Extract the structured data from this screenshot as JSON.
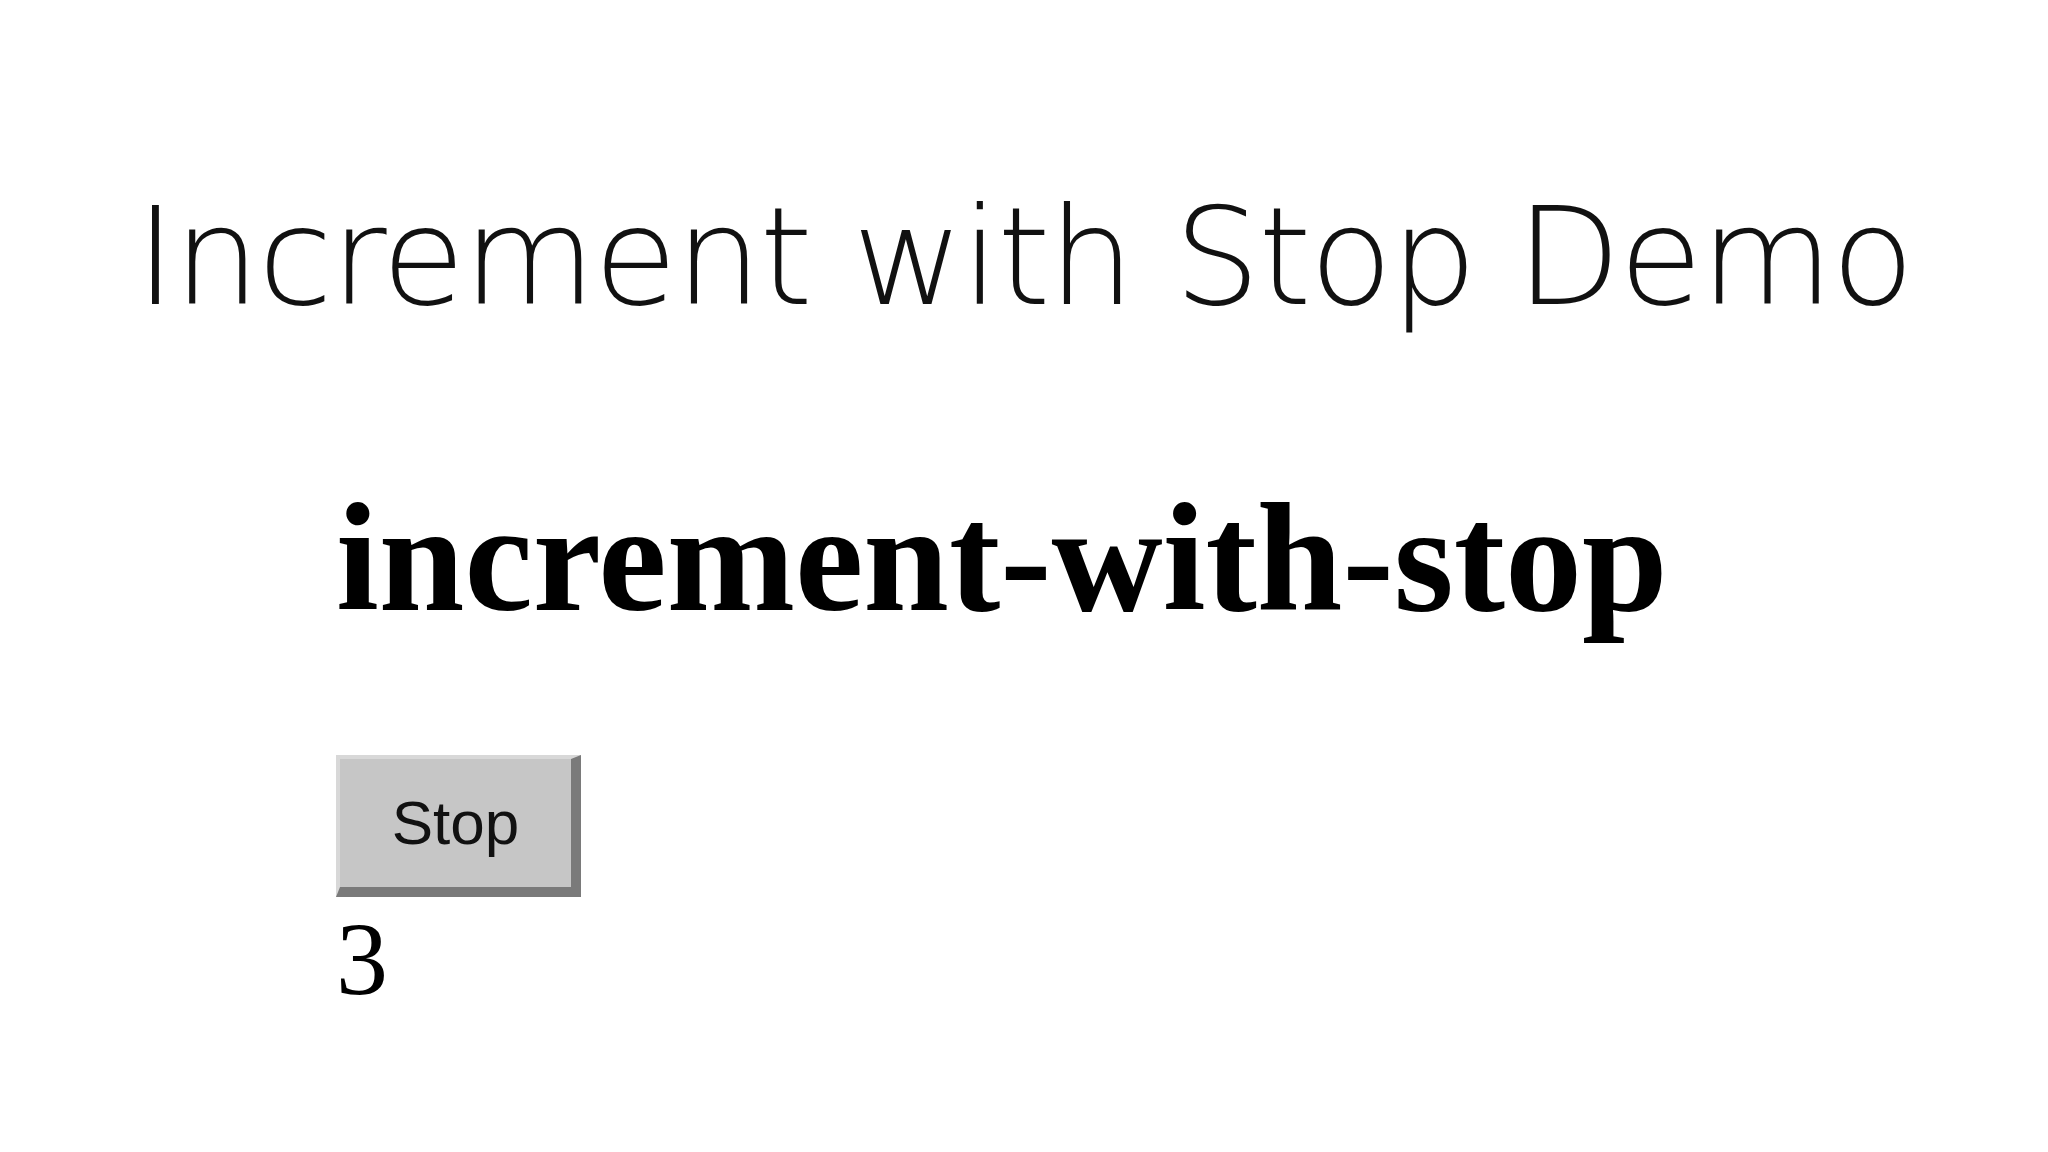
{
  "title": "Increment with Stop Demo",
  "heading": "increment-with-stop",
  "button": {
    "label": "Stop"
  },
  "counter": "3"
}
